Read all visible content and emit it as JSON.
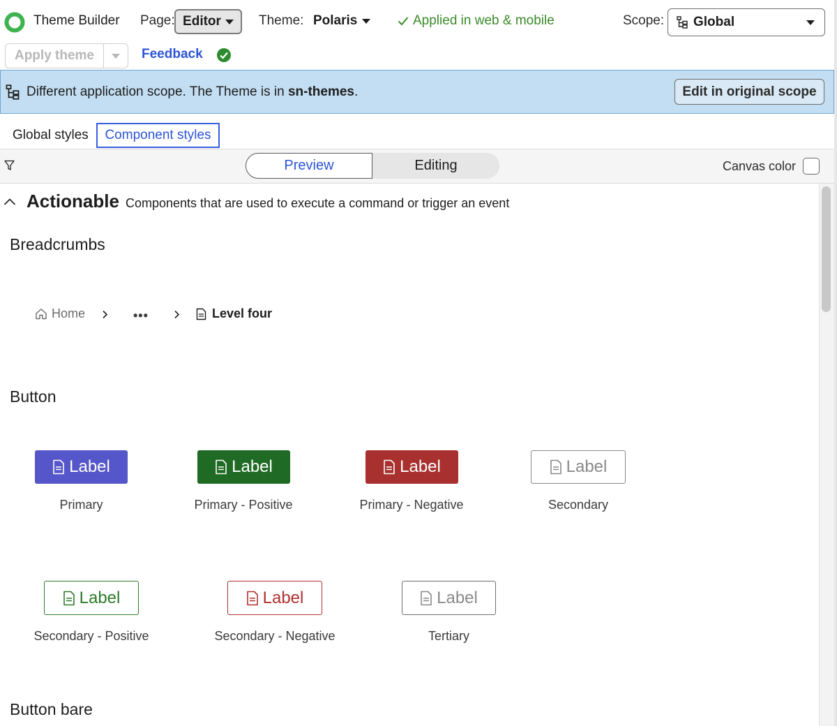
{
  "header": {
    "app_title": "Theme Builder",
    "page_label": "Page:",
    "page_value": "Editor",
    "theme_label": "Theme:",
    "theme_value": "Polaris",
    "status_text": "Applied in web & mobile",
    "scope_label": "Scope:",
    "scope_value": "Global"
  },
  "actions": {
    "apply_theme": "Apply theme",
    "feedback": "Feedback"
  },
  "banner": {
    "text_prefix": "Different application scope. The Theme is in ",
    "text_scope": "sn-themes",
    "text_suffix": ".",
    "button": "Edit in original scope"
  },
  "tabs": {
    "global": "Global styles",
    "component": "Component styles"
  },
  "toolbar": {
    "preview": "Preview",
    "editing": "Editing",
    "canvas_color": "Canvas color"
  },
  "section": {
    "title": "Actionable",
    "description": "Components that are used to execute a command or trigger an event"
  },
  "breadcrumbs": {
    "heading": "Breadcrumbs",
    "home": "Home",
    "ellipsis": "•••",
    "current": "Level four"
  },
  "buttons": {
    "heading": "Button",
    "items": [
      {
        "label": "Label",
        "caption": "Primary",
        "color": "#5556c9"
      },
      {
        "label": "Label",
        "caption": "Primary - Positive",
        "color": "#1f6a24"
      },
      {
        "label": "Label",
        "caption": "Primary - Negative",
        "color": "#a8302e"
      },
      {
        "label": "Label",
        "caption": "Secondary",
        "color": "#8a8a8a"
      },
      {
        "label": "Label",
        "caption": "Secondary - Positive",
        "color": "#2e7a2a"
      },
      {
        "label": "Label",
        "caption": "Secondary - Negative",
        "color": "#b0312f"
      },
      {
        "label": "Label",
        "caption": "Tertiary",
        "color": "#6e6e6e"
      }
    ]
  },
  "button_bare": {
    "heading": "Button bare"
  },
  "colors": {
    "accent": "#2d55d6",
    "banner_bg": "#c3def2",
    "success": "#3a8a2a"
  }
}
